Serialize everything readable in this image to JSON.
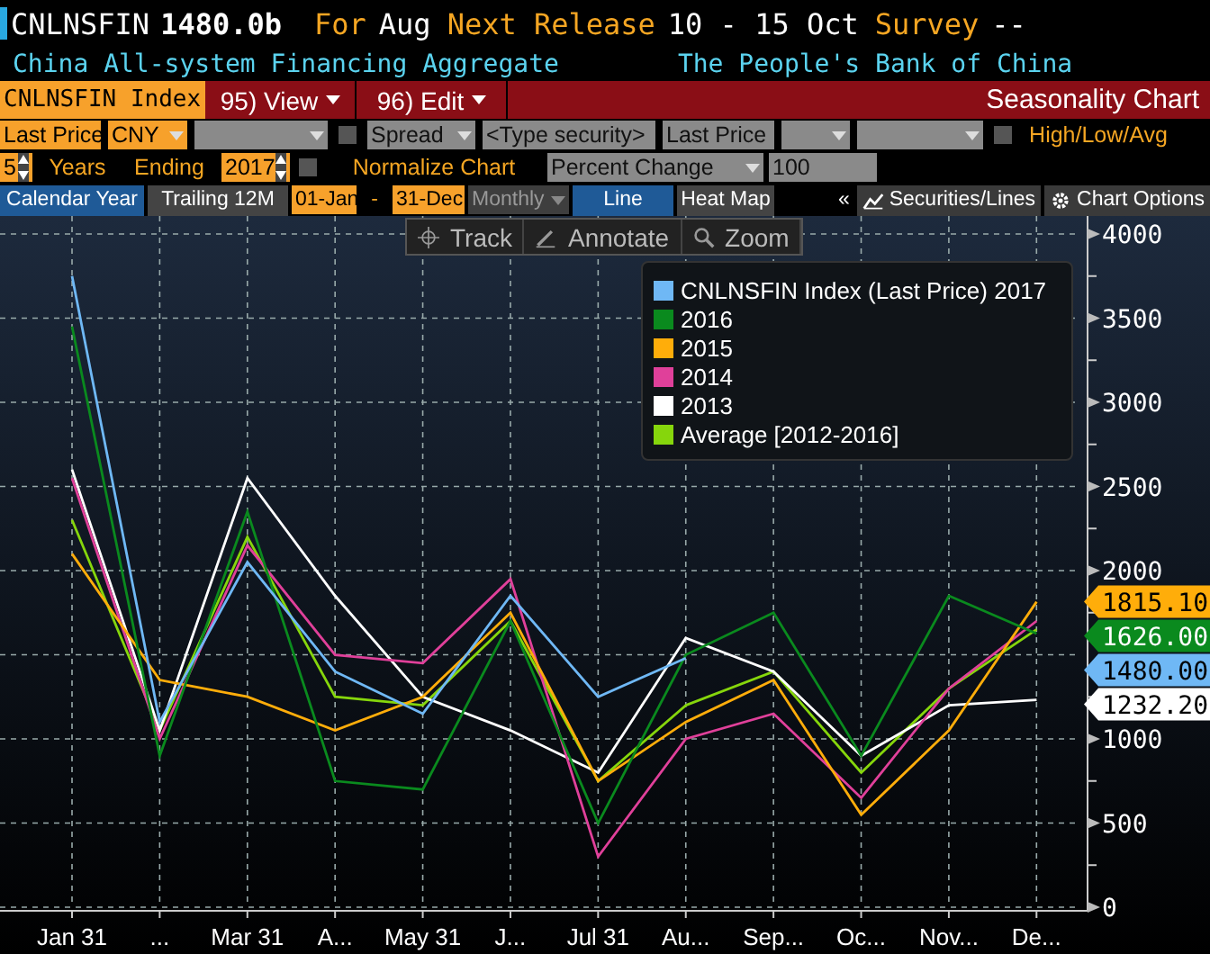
{
  "header": {
    "ticker": "CNLNSFIN",
    "value": "1480.0b",
    "for_label": "For",
    "for_value": "Aug",
    "release_label": "Next Release",
    "release_value": "10 - 15 Oct",
    "survey_label": "Survey",
    "survey_value": "--",
    "name": "China All-system Financing Aggregate",
    "source": "The People's Bank of China"
  },
  "menu_bar": {
    "security": "CNLNSFIN Index",
    "menus": [
      {
        "label": "95) View"
      },
      {
        "label": "96) Edit"
      }
    ],
    "title": "Seasonality Chart"
  },
  "row_1": [
    {
      "kind": "field",
      "disabled": false,
      "value": "Last Price"
    },
    {
      "kind": "select",
      "disabled": false,
      "value": "CNY"
    },
    {
      "kind": "select",
      "disabled": true
    },
    {
      "kind": "check",
      "checked": false
    },
    {
      "kind": "select",
      "disabled": true,
      "value": "Spread"
    },
    {
      "kind": "field",
      "disabled": true,
      "value": "<Type security>"
    },
    {
      "kind": "field",
      "disabled": true,
      "value": "Last Price"
    },
    {
      "kind": "select",
      "disabled": true
    },
    {
      "kind": "select",
      "disabled": true
    },
    {
      "kind": "check",
      "checked": false
    },
    {
      "kind": "text",
      "value": "High/Low/Avg"
    }
  ],
  "row_2": [
    {
      "kind": "spin",
      "value": "5"
    },
    {
      "kind": "text",
      "value": "Years"
    },
    {
      "kind": "text",
      "value": "Ending"
    },
    {
      "kind": "spin",
      "value": "2017"
    },
    {
      "kind": "check",
      "checked": false
    },
    {
      "kind": "text",
      "value": "Normalize Chart"
    },
    {
      "kind": "select",
      "disabled": true,
      "value": "Percent Change"
    },
    {
      "kind": "field",
      "disabled": true,
      "value": "100"
    }
  ],
  "row_3": [
    {
      "kind": "tab",
      "selected": true,
      "value": "Calendar Year"
    },
    {
      "kind": "tab",
      "selected": false,
      "value": "Trailing 12M"
    },
    {
      "kind": "field",
      "disabled": false,
      "value": "01-Jan"
    },
    {
      "kind": "text",
      "value": "-"
    },
    {
      "kind": "field",
      "disabled": false,
      "value": "31-Dec"
    },
    {
      "kind": "select",
      "disabled": true,
      "value": "Monthly"
    },
    {
      "kind": "tab",
      "selected": true,
      "value": "Line"
    },
    {
      "kind": "tab",
      "selected": false,
      "value": "Heat Map"
    }
  ],
  "collapse": "«",
  "tools": [
    {
      "label": "Securities/Lines"
    },
    {
      "label": "Chart Options"
    }
  ],
  "chart_toolbar": [
    {
      "label": "Track"
    },
    {
      "label": "Annotate"
    },
    {
      "label": "Zoom"
    }
  ],
  "chart_data": {
    "type": "line",
    "categories": [
      "Jan 31",
      "...",
      "Mar 31",
      "A...",
      "May 31",
      "J...",
      "Jul 31",
      "Au...",
      "Sep...",
      "Oc...",
      "Nov...",
      "De..."
    ],
    "ylim": [
      0,
      4000
    ],
    "yticks": [
      0,
      500,
      1000,
      2000,
      2500,
      3000,
      3500,
      4000
    ],
    "grid": true,
    "legend": true,
    "series": [
      {
        "name": "CNLNSFIN Index (Last Price) 2017",
        "color": "#6fb8f5",
        "values": [
          3750,
          1100,
          2050,
          1400,
          1150,
          1850,
          1250,
          1480,
          null,
          null,
          null,
          null
        ]
      },
      {
        "name": "2016",
        "color": "#0a8a1e",
        "values": [
          3450,
          900,
          2350,
          750,
          700,
          1700,
          500,
          1500,
          1750,
          900,
          1850,
          1626
        ]
      },
      {
        "name": "2015",
        "color": "#ffad0a",
        "values": [
          2100,
          1350,
          1250,
          1050,
          1250,
          1750,
          750,
          1100,
          1350,
          550,
          1050,
          1815
        ]
      },
      {
        "name": "2014",
        "color": "#e0409a",
        "values": [
          2550,
          1000,
          2150,
          1500,
          1450,
          1950,
          300,
          1000,
          1150,
          650,
          1300,
          1700
        ]
      },
      {
        "name": "2013",
        "color": "#ffffff",
        "values": [
          2600,
          1050,
          2550,
          1850,
          1250,
          1050,
          800,
          1600,
          1400,
          900,
          1200,
          1232
        ]
      },
      {
        "name": "Average [2012-2016]",
        "color": "#86d60c",
        "values": [
          2300,
          1050,
          2200,
          1250,
          1200,
          1700,
          750,
          1200,
          1400,
          800,
          1300,
          1650
        ]
      }
    ]
  },
  "last_value_tags": [
    {
      "text": "1815.10",
      "color": "#ffad0a"
    },
    {
      "text": "1626.00",
      "color": "#0a8a1e"
    },
    {
      "text": "1480.00",
      "color": "#6fb8f5"
    },
    {
      "text": "1232.20",
      "color": "#ffffff"
    }
  ]
}
